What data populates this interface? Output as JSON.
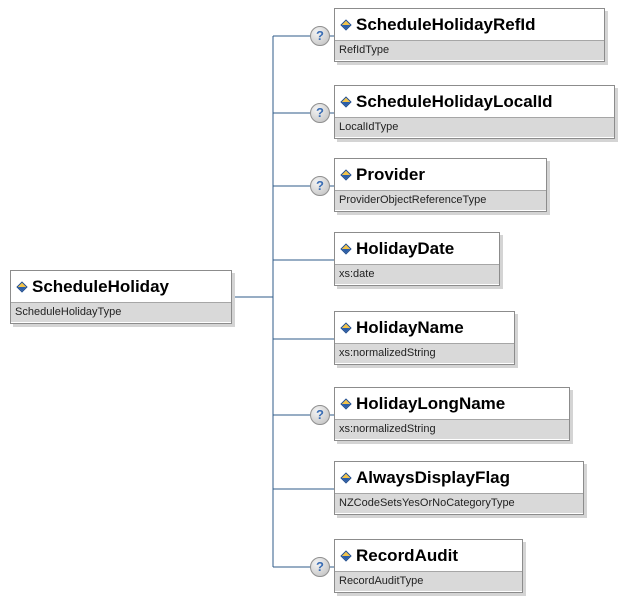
{
  "root": {
    "name": "ScheduleHoliday",
    "type": "ScheduleHolidayType"
  },
  "optional_marker": "?",
  "children": [
    {
      "name": "ScheduleHolidayRefId",
      "type": "RefIdType",
      "optional": true
    },
    {
      "name": "ScheduleHolidayLocalId",
      "type": "LocalIdType",
      "optional": true
    },
    {
      "name": "Provider",
      "type": "ProviderObjectReferenceType",
      "optional": true
    },
    {
      "name": "HolidayDate",
      "type": "xs:date",
      "optional": false
    },
    {
      "name": "HolidayName",
      "type": "xs:normalizedString",
      "optional": false
    },
    {
      "name": "HolidayLongName",
      "type": "xs:normalizedString",
      "optional": true
    },
    {
      "name": "AlwaysDisplayFlag",
      "type": "NZCodeSetsYesOrNoCategoryType",
      "optional": false
    },
    {
      "name": "RecordAudit",
      "type": "RecordAuditType",
      "optional": true
    }
  ],
  "colors": {
    "connector": "#2f5b8a",
    "icon_gold": "#f3c347",
    "icon_blue": "#2b5ea8"
  }
}
